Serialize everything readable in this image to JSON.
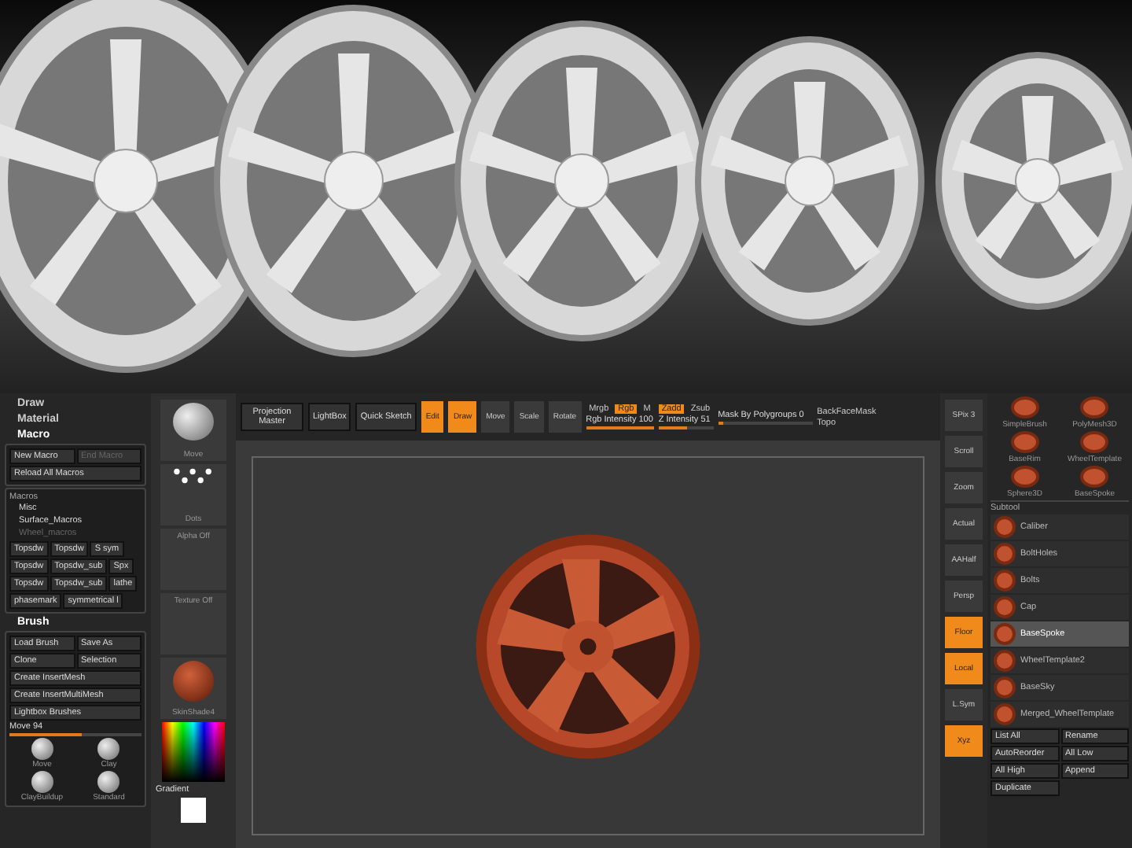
{
  "left_panel": {
    "menus": [
      {
        "label": "Draw",
        "expanded": false
      },
      {
        "label": "Material",
        "expanded": false
      },
      {
        "label": "Macro",
        "expanded": true
      }
    ],
    "macro_buttons": [
      {
        "label": "New Macro",
        "disabled": false
      },
      {
        "label": "End Macro",
        "disabled": true
      },
      {
        "label": "Reload All Macros",
        "disabled": false
      }
    ],
    "macros_title": "Macros",
    "macro_folders": [
      {
        "label": "Misc",
        "disabled": false
      },
      {
        "label": "Surface_Macros",
        "disabled": false
      },
      {
        "label": "Wheel_macros",
        "disabled": true
      }
    ],
    "macro_items": [
      "Topsdw",
      "Topsdw",
      "S sym",
      "Topsdw",
      "Topsdw_sub",
      "Spx",
      "Topsdw",
      "Topsdw_sub",
      "lathe",
      "phasemark",
      "symmetrical l"
    ],
    "brush_title": "Brush",
    "brush_buttons": [
      "Load Brush",
      "Save As",
      "Clone",
      "Selection",
      "Create InsertMesh",
      "Create InsertMultiMesh",
      "Lightbox Brushes"
    ],
    "brush_slider": {
      "label": "Move 94",
      "level": 0.55
    },
    "brushes": [
      "Move",
      "Clay",
      "ClayBuildup",
      "Standard"
    ]
  },
  "shelf": {
    "items": [
      {
        "kind": "brush",
        "label": "Move"
      },
      {
        "kind": "stroke",
        "label": "Dots"
      },
      {
        "kind": "empty",
        "label": "Alpha Off"
      },
      {
        "kind": "empty",
        "label": "Texture Off"
      },
      {
        "kind": "material",
        "label": "SkinShade4"
      },
      {
        "kind": "picker",
        "label": "Gradient"
      },
      {
        "kind": "swatch"
      }
    ]
  },
  "toolbar": {
    "buttons": [
      "Projection Master",
      "LightBox",
      "Quick Sketch"
    ],
    "modes": [
      {
        "label": "Edit",
        "on": true
      },
      {
        "label": "Draw",
        "on": true
      },
      {
        "label": "Move",
        "on": false
      },
      {
        "label": "Scale",
        "on": false
      },
      {
        "label": "Rotate",
        "on": false
      }
    ],
    "color": {
      "toggles": [
        {
          "label": "Mrgb",
          "on": false
        },
        {
          "label": "Rgb",
          "on": true
        },
        {
          "label": "M",
          "on": false
        }
      ],
      "intensity": {
        "label": "Rgb Intensity 100",
        "level": 1
      }
    },
    "depth": {
      "toggles": [
        {
          "label": "Zadd",
          "on": true
        },
        {
          "label": "Zsub",
          "on": false
        }
      ],
      "intensity": {
        "label": "Z Intensity 51",
        "level": 0.51
      }
    },
    "mask": {
      "label": "Mask By Polygroups 0",
      "level": 0.05
    },
    "backface": "BackFaceMask",
    "topo": "Topo"
  },
  "right_shelf": [
    {
      "label": "SPix 3",
      "on": false
    },
    {
      "label": "Scroll",
      "on": false
    },
    {
      "label": "Zoom",
      "on": false
    },
    {
      "label": "Actual",
      "on": false
    },
    {
      "label": "AAHalf",
      "on": false
    },
    {
      "label": "Persp",
      "on": false
    },
    {
      "label": "Floor",
      "on": true
    },
    {
      "label": "Local",
      "on": true
    },
    {
      "label": "L.Sym",
      "on": false
    },
    {
      "label": "Xyz",
      "on": true
    }
  ],
  "tool_panel": {
    "tools": [
      "SimpleBrush",
      "PolyMesh3D",
      "BaseRim",
      "WheelTemplate",
      "Sphere3D",
      "BaseSpoke"
    ],
    "subtool_title": "Subtool",
    "subtools": [
      {
        "label": "Caliber",
        "selected": false
      },
      {
        "label": "BoltHoles",
        "selected": false
      },
      {
        "label": "Bolts",
        "selected": false
      },
      {
        "label": "Cap",
        "selected": false
      },
      {
        "label": "BaseSpoke",
        "selected": true
      },
      {
        "label": "WheelTemplate2",
        "selected": false
      },
      {
        "label": "BaseSky",
        "selected": false
      },
      {
        "label": "Merged_WheelTemplate",
        "selected": false
      }
    ],
    "buttons": [
      "List All",
      "Rename",
      "AutoReorder",
      "All Low",
      "All High",
      "Append",
      "Duplicate"
    ]
  }
}
